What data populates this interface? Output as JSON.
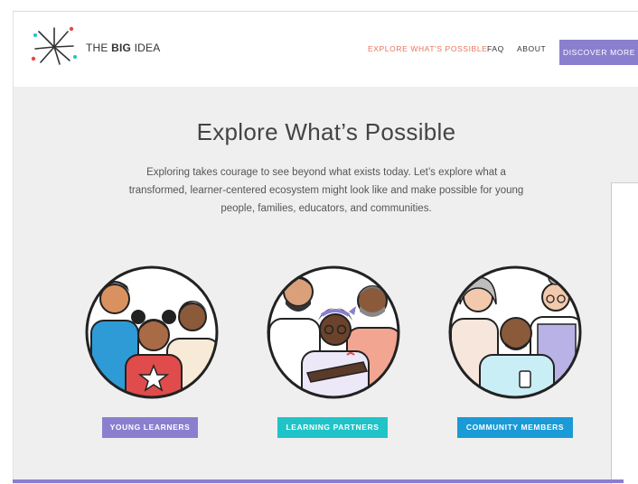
{
  "brand": {
    "prefix": "THE",
    "bold": "BIG",
    "suffix": "IDEA"
  },
  "nav": {
    "explore": "EXPLORE WHAT'S POSSIBLE",
    "faq": "FAQ",
    "about": "ABOUT",
    "cta": "DISCOVER MORE"
  },
  "hero": {
    "title": "Explore What’s Possible",
    "line1": "Exploring takes courage to see beyond what exists today. Let’s explore what a",
    "line2": "transformed, learner-centered ecosystem might look like and make possible for young",
    "line3": "people, families, educators, and communities."
  },
  "cards": [
    {
      "label": "YOUNG LEARNERS",
      "color": "#8a7fcf"
    },
    {
      "label": "LEARNING PARTNERS",
      "color": "#1fc3c8"
    },
    {
      "label": "COMMUNITY MEMBERS",
      "color": "#1a9ad6"
    }
  ],
  "colors": {
    "accent": "#8a7fcf",
    "nav_active": "#e8735a",
    "background": "#efefef"
  }
}
